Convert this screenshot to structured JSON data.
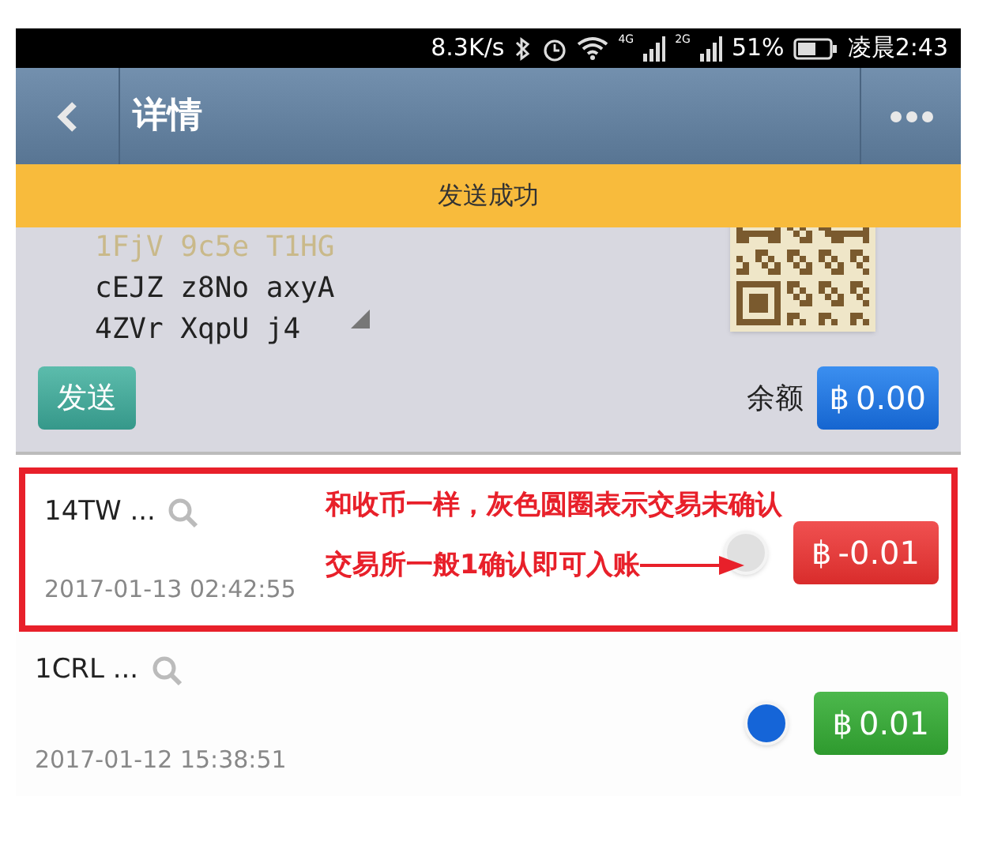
{
  "status_bar": {
    "speed": "8.3K/s",
    "net_a": "4G",
    "net_b": "2G",
    "battery": "51%",
    "time": "凌晨2:43"
  },
  "header": {
    "title": "详情"
  },
  "toast": {
    "text": "发送成功"
  },
  "address": {
    "lines": [
      "1FjV 9c5e T1HG",
      "cEJZ z8No axyA",
      "4ZVr XqpU j4"
    ]
  },
  "send_button": "发送",
  "balance": {
    "label": "余额",
    "symbol": "฿",
    "amount": "0.00"
  },
  "transactions": [
    {
      "address": "14TW ...",
      "time": "2017-01-13 02:42:55",
      "color": "#e0e0e0",
      "kind": "outgoing",
      "symbol": "฿",
      "amount": "-0.01",
      "annotation": {
        "lines": [
          "和收币一样，灰色圆圈表示交易未确认",
          "交易所一般1确认即可入账"
        ]
      }
    },
    {
      "address": "1CRL ...",
      "time": "2017-01-12 15:38:51",
      "color": "#1565d8",
      "kind": "incoming",
      "symbol": "฿",
      "amount": "0.01"
    }
  ]
}
